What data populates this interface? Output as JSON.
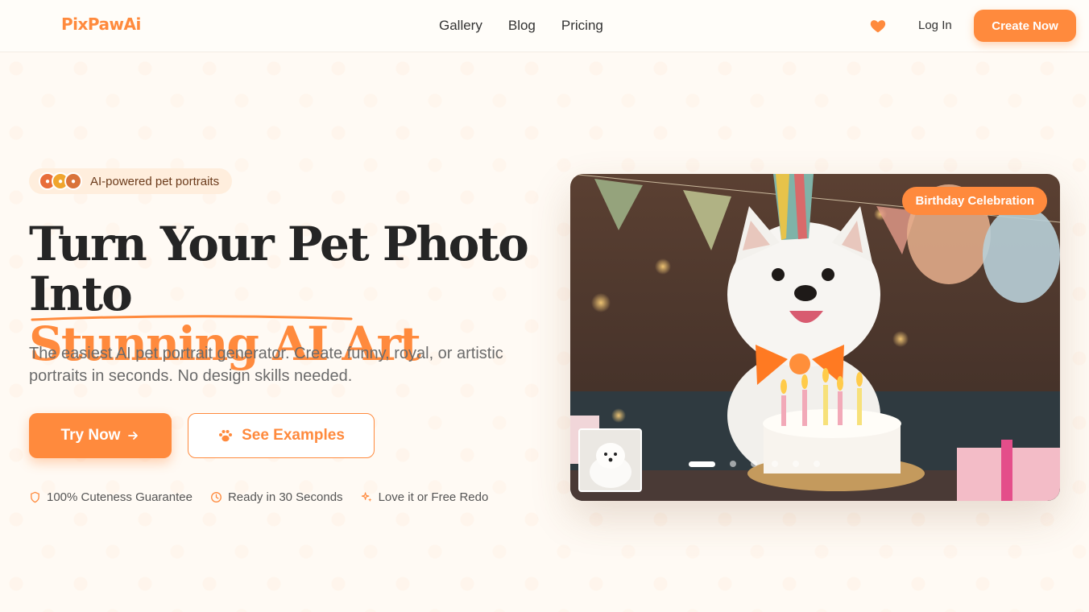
{
  "nav": {
    "logo": "PixPawAi",
    "links": [
      "Gallery",
      "Blog",
      "Pricing"
    ],
    "login": "Log In",
    "cta": "Create Now"
  },
  "hero": {
    "badge": "AI-powered pet portraits",
    "headline_line1": "Turn Your Pet Photo Into",
    "headline_accent": "Stunning AI Art",
    "subtitle": "The easiest AI pet portrait generator. Create funny, royal, or artistic portraits in seconds. No design skills needed.",
    "try_button": "Try Now",
    "see_button": "See Examples",
    "features": [
      {
        "icon": "shield-icon",
        "text": "100% Cuteness Guarantee"
      },
      {
        "icon": "clock-icon",
        "text": "Ready in 30 Seconds"
      },
      {
        "icon": "sparkle-icon",
        "text": "Love it or Free Redo"
      }
    ],
    "showcase": {
      "tag": "Birthday Celebration",
      "slide_count": 6,
      "active_slide": 0
    }
  },
  "colors": {
    "accent": "#ff8a3d",
    "background": "#fffaf4",
    "text": "#252525"
  }
}
